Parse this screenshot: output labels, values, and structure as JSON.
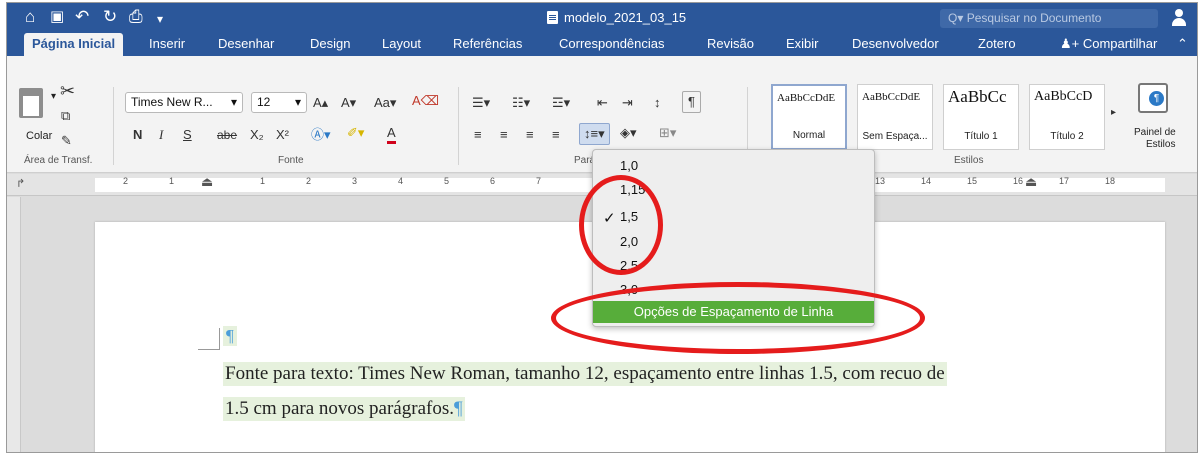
{
  "window": {
    "title": "modelo_2021_03_15",
    "search_placeholder": "Pesquisar no Documento"
  },
  "quick_access": [
    "home-icon",
    "save-icon",
    "undo-icon",
    "redo-icon",
    "print-icon",
    "customize-icon"
  ],
  "tabs": [
    "Página Inicial",
    "Inserir",
    "Desenhar",
    "Design",
    "Layout",
    "Referências",
    "Correspondências",
    "Revisão",
    "Exibir",
    "Desenvolvedor",
    "Zotero"
  ],
  "share_label": "Compartilhar",
  "clipboard": {
    "paste_label": "Colar",
    "group_label": "Área de Transf."
  },
  "font": {
    "name": "Times New R...",
    "size": "12",
    "group_label": "Fonte",
    "bold": "N",
    "italic": "I",
    "underline": "S",
    "strike": "abe",
    "subscript": "X₂",
    "superscript": "X²",
    "color_letter": "A"
  },
  "paragraph": {
    "group_label": "Pará"
  },
  "styles": {
    "group_label": "Estilos",
    "items": [
      {
        "preview": "AaBbCcDdE",
        "name": "Normal"
      },
      {
        "preview": "AaBbCcDdE",
        "name": "Sem Espaça..."
      },
      {
        "preview": "AaBbCc",
        "name": "Título 1"
      },
      {
        "preview": "AaBbCcD",
        "name": "Título 2"
      }
    ],
    "pane_label_1": "Painel de",
    "pane_label_2": "Estilos"
  },
  "ruler_numbers": [
    "2",
    "1",
    "1",
    "2",
    "3",
    "4",
    "5",
    "6",
    "7",
    "13",
    "14",
    "15",
    "16",
    "17",
    "18"
  ],
  "line_spacing_menu": {
    "options": [
      "1,0",
      "1,15",
      "1,5",
      "2,0",
      "2,5",
      "3,0"
    ],
    "selected": "1,5",
    "more_options": "Opções de Espaçamento de Linha"
  },
  "document": {
    "empty_para": "¶",
    "line1": "Fonte para texto: Times New Roman, tamanho 12, espaçamento entre linhas 1.5, com recuo de",
    "line2": "1.5 cm para novos parágrafos.",
    "para_mark": "¶"
  },
  "colors": {
    "accent": "#2b579a",
    "highlight_menu": "#57ad3a",
    "annotation": "#e51c1c",
    "text_highlight": "#e6f1dd"
  }
}
